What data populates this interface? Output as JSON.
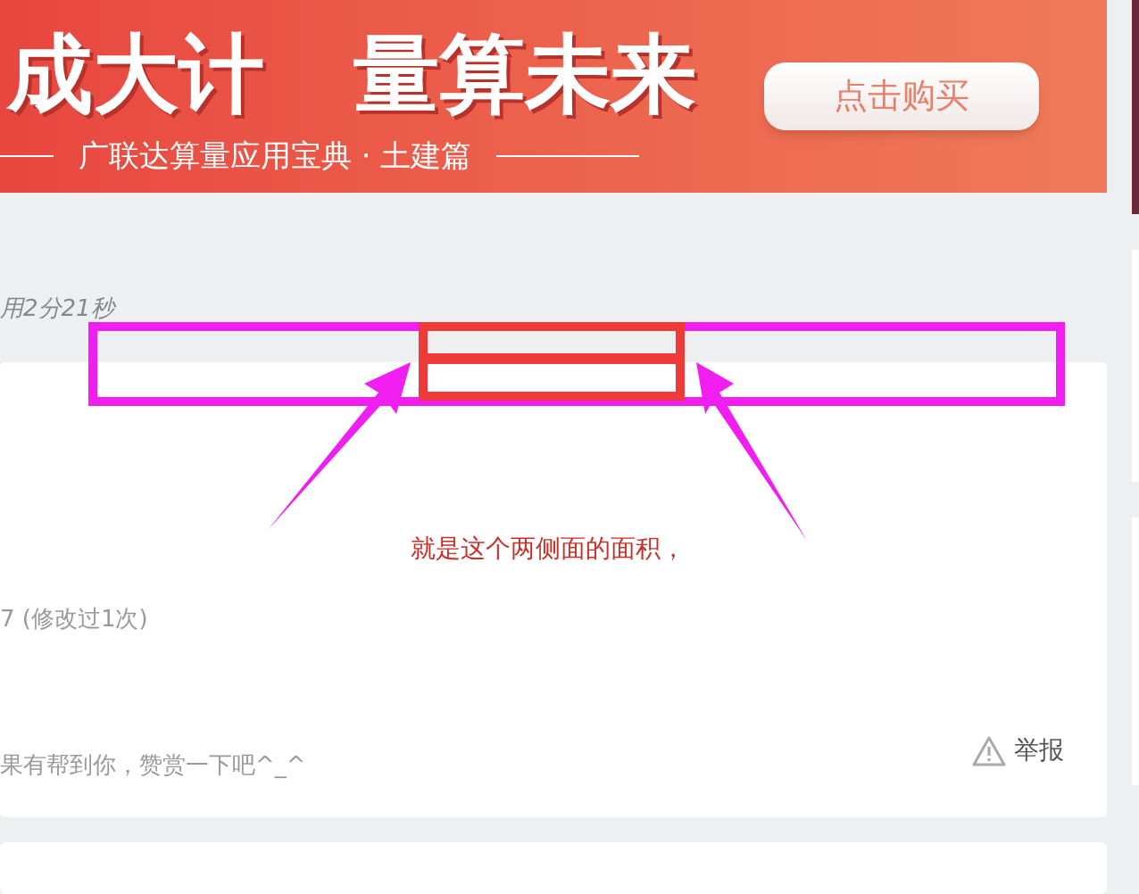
{
  "banner": {
    "headline": [
      "成大计",
      "量算未来"
    ],
    "subtitle": "广联达算量应用宝典 · 土建篇",
    "button": "点击购买"
  },
  "elapsed": "用2分21秒",
  "annotation": {
    "label": "就是这个两侧面的面积，"
  },
  "answer": {
    "edit_info": "7 (修改过1次)",
    "reward_text": "果有帮到你，赞赏一下吧^_^",
    "report": "举报"
  }
}
